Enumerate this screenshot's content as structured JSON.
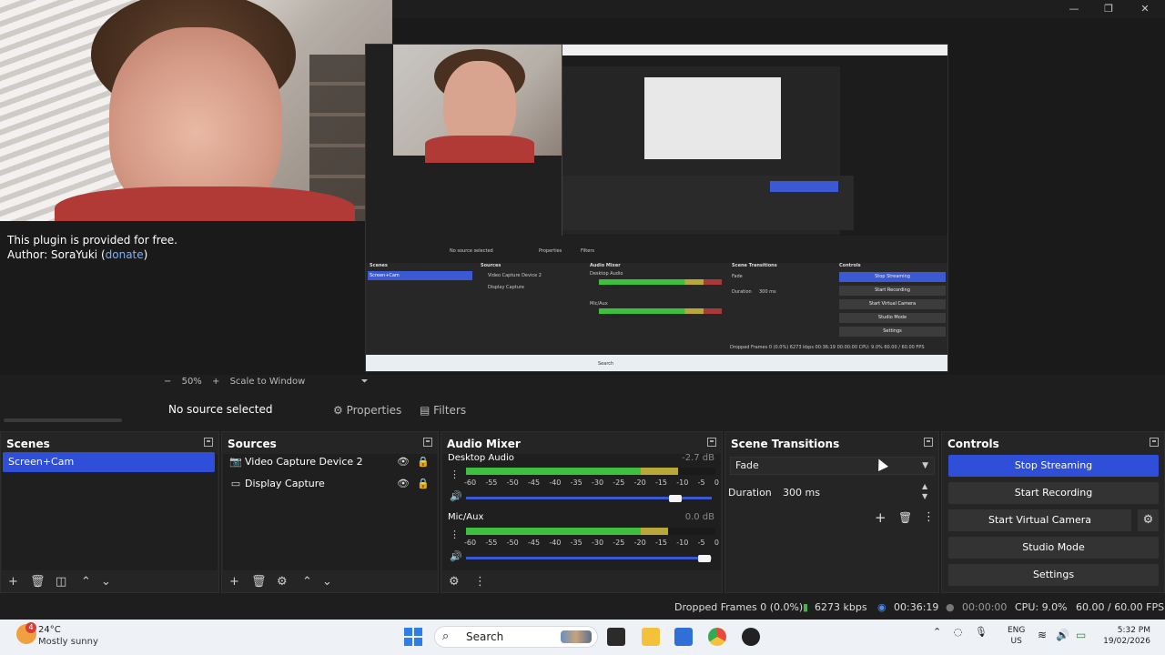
{
  "window": {
    "minimize": "—",
    "restore": "❐",
    "close": "✕"
  },
  "plugin": {
    "line1": "This plugin is provided for free.",
    "author_prefix": "Author: SoraYuki (",
    "author_link": "donate",
    "author_suffix": ")"
  },
  "nested_preview": {
    "no_source": "No source selected",
    "properties": "Properties",
    "filters": "Filters",
    "scenes": "Scenes",
    "sources": "Sources",
    "audio_mixer": "Audio Mixer",
    "scene_transitions": "Scene Transitions",
    "controls": "Controls",
    "scene_item": "Screen+Cam",
    "src1": "Video Capture Device 2",
    "src2": "Display Capture",
    "desktop_audio": "Desktop Audio",
    "mic": "Mic/Aux",
    "fade": "Fade",
    "duration": "Duration",
    "duration_val": "300 ms",
    "stop_streaming": "Stop Streaming",
    "start_recording": "Start Recording",
    "start_virtual_camera": "Start Virtual Camera",
    "studio_mode": "Studio Mode",
    "settings": "Settings",
    "search": "Search",
    "status": "Dropped Frames 0 (0.0%)   6273 kbps   00:36:19   00:00:00   CPU: 9.0%   60.00 / 60.00 FPS"
  },
  "zoombar": {
    "minus": "−",
    "zoom": "50%",
    "plus": "+",
    "scale_mode": "Scale to Window",
    "dropdown": "⏷"
  },
  "context": {
    "no_source": "No source selected",
    "properties": "Properties",
    "filters": "Filters"
  },
  "scenes": {
    "title": "Scenes",
    "items": [
      "Screen+Cam"
    ],
    "selected_index": 0
  },
  "sources": {
    "title": "Sources",
    "items": [
      {
        "label": "Video Capture Device 2",
        "icon": "camera-icon",
        "visible": true,
        "locked": false
      },
      {
        "label": "Display Capture",
        "icon": "monitor-icon",
        "visible": true,
        "locked": false
      }
    ]
  },
  "audio_mixer": {
    "title": "Audio Mixer",
    "scale": [
      "-60",
      "-55",
      "-50",
      "-45",
      "-40",
      "-35",
      "-30",
      "-25",
      "-20",
      "-15",
      "-10",
      "-5",
      "0"
    ],
    "channels": [
      {
        "name": "Desktop Audio",
        "db": "-2.7 dB",
        "level": 0.85,
        "volume": 0.85
      },
      {
        "name": "Mic/Aux",
        "db": "0.0 dB",
        "level": 0.81,
        "volume": 0.97
      }
    ]
  },
  "transitions": {
    "title": "Scene Transitions",
    "selected": "Fade",
    "duration_label": "Duration",
    "duration_value": "300 ms"
  },
  "controls": {
    "title": "Controls",
    "stop_streaming": "Stop Streaming",
    "start_recording": "Start Recording",
    "start_virtual_camera": "Start Virtual Camera",
    "studio_mode": "Studio Mode",
    "settings": "Settings"
  },
  "status": {
    "dropped": "Dropped Frames 0 (0.0%)",
    "kbps": "6273 kbps",
    "stream_time": "00:36:19",
    "rec_time": "00:00:00",
    "cpu": "CPU: 9.0%",
    "fps": "60.00 / 60.00 FPS"
  },
  "taskbar": {
    "weather_badge": "4",
    "temp": "24°C",
    "condition": "Mostly sunny",
    "search": "Search",
    "lang1": "ENG",
    "lang2": "US",
    "time": "5:32 PM",
    "date": "19/02/2026"
  },
  "colors": {
    "accent": "#2f4fd8",
    "meter_green": "#3fbf3f",
    "meter_yellow": "#b8a83a",
    "meter_red": "#a83a3a"
  }
}
